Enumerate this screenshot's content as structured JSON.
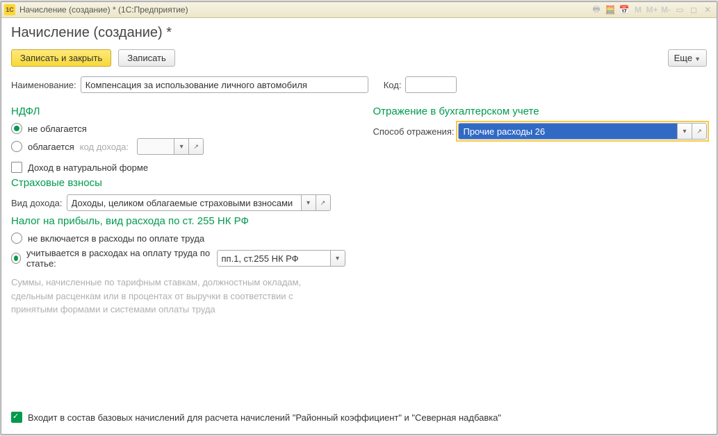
{
  "titlebar": {
    "logo": "1C",
    "title": "Начисление (создание) *  (1С:Предприятие)"
  },
  "page_title": "Начисление (создание) *",
  "toolbar": {
    "save_close": "Записать и закрыть",
    "save": "Записать",
    "more": "Еще"
  },
  "fields": {
    "name_label": "Наименование:",
    "name_value": "Компенсация за использование личного автомобиля",
    "code_label": "Код:",
    "code_value": ""
  },
  "ndfl": {
    "header": "НДФЛ",
    "opt_not_taxed": "не облагается",
    "opt_taxed": "облагается",
    "income_code_label": "код дохода:",
    "chk_natural": "Доход в натуральной форме"
  },
  "accounting": {
    "header": "Отражение в бухгалтерском учете",
    "method_label": "Способ отражения:",
    "method_value": "Прочие расходы 26"
  },
  "insurance": {
    "header": "Страховые взносы",
    "type_label": "Вид дохода:",
    "type_value": "Доходы, целиком облагаемые страховыми взносами"
  },
  "profit_tax": {
    "header": "Налог на прибыль, вид расхода по ст. 255 НК РФ",
    "opt_not_included": "не включается в расходы по оплате труда",
    "opt_included": "учитывается в расходах на оплату труда по статье:",
    "article_value": "пп.1, ст.255 НК РФ",
    "description": "Суммы, начисленные по тарифным ставкам, должностным окладам, сдельным расценкам или в процентах от выручки в соответствии с принятыми формами и системами оплаты труда"
  },
  "footer": {
    "base_chk": "Входит в состав базовых начислений для расчета начислений \"Районный коэффициент\" и \"Северная надбавка\""
  }
}
